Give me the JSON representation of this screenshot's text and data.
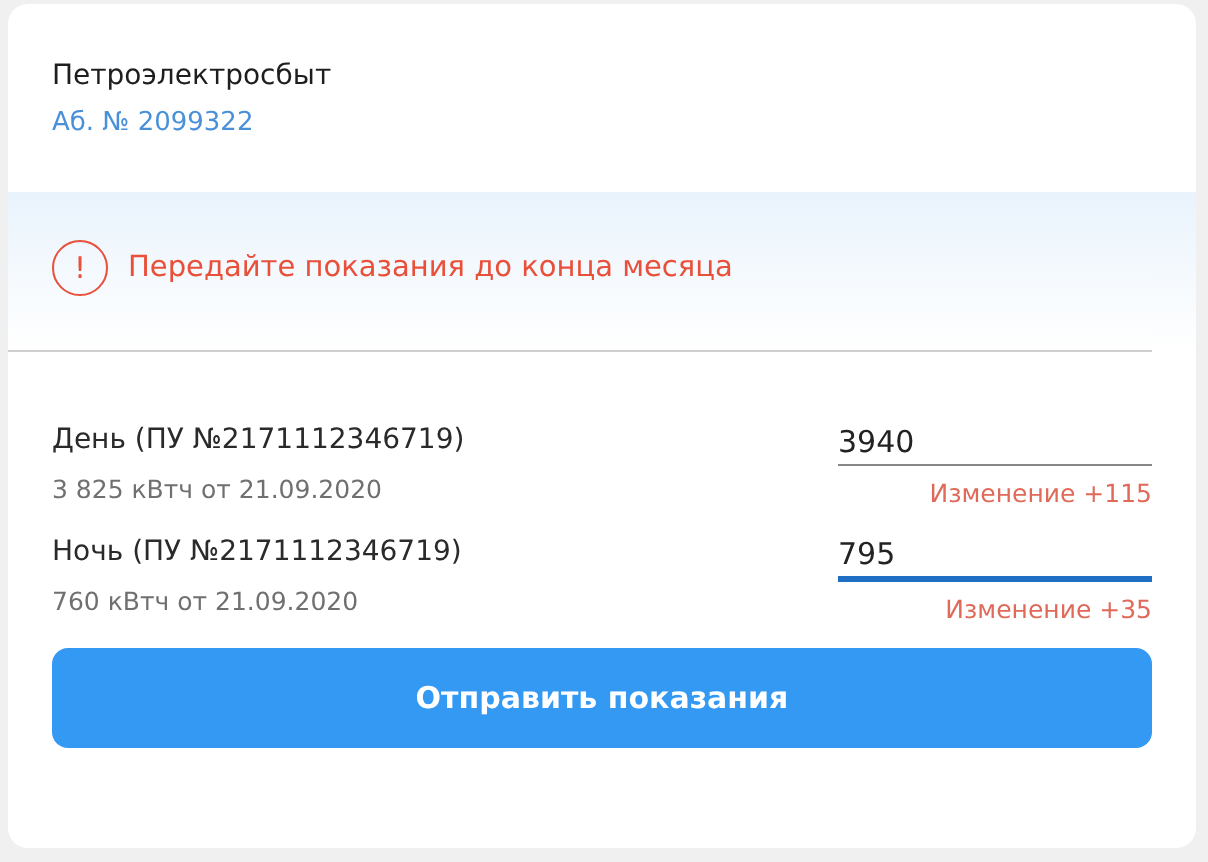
{
  "provider": {
    "name": "Петроэлектросбыт",
    "account": "Аб. № 2099322"
  },
  "alert": {
    "icon": "!",
    "text": "Передайте показания до конца месяца"
  },
  "readings": [
    {
      "label": "День (ПУ №2171112346719)",
      "previous": "3 825 кВтч от 21.09.2020",
      "value": "3940",
      "focused": false,
      "change": "Изменение +115"
    },
    {
      "label": "Ночь (ПУ №2171112346719)",
      "previous": "760 кВтч от 21.09.2020",
      "value": "795",
      "focused": true,
      "change": "Изменение +35"
    }
  ],
  "submit": {
    "label": "Отправить показания"
  }
}
